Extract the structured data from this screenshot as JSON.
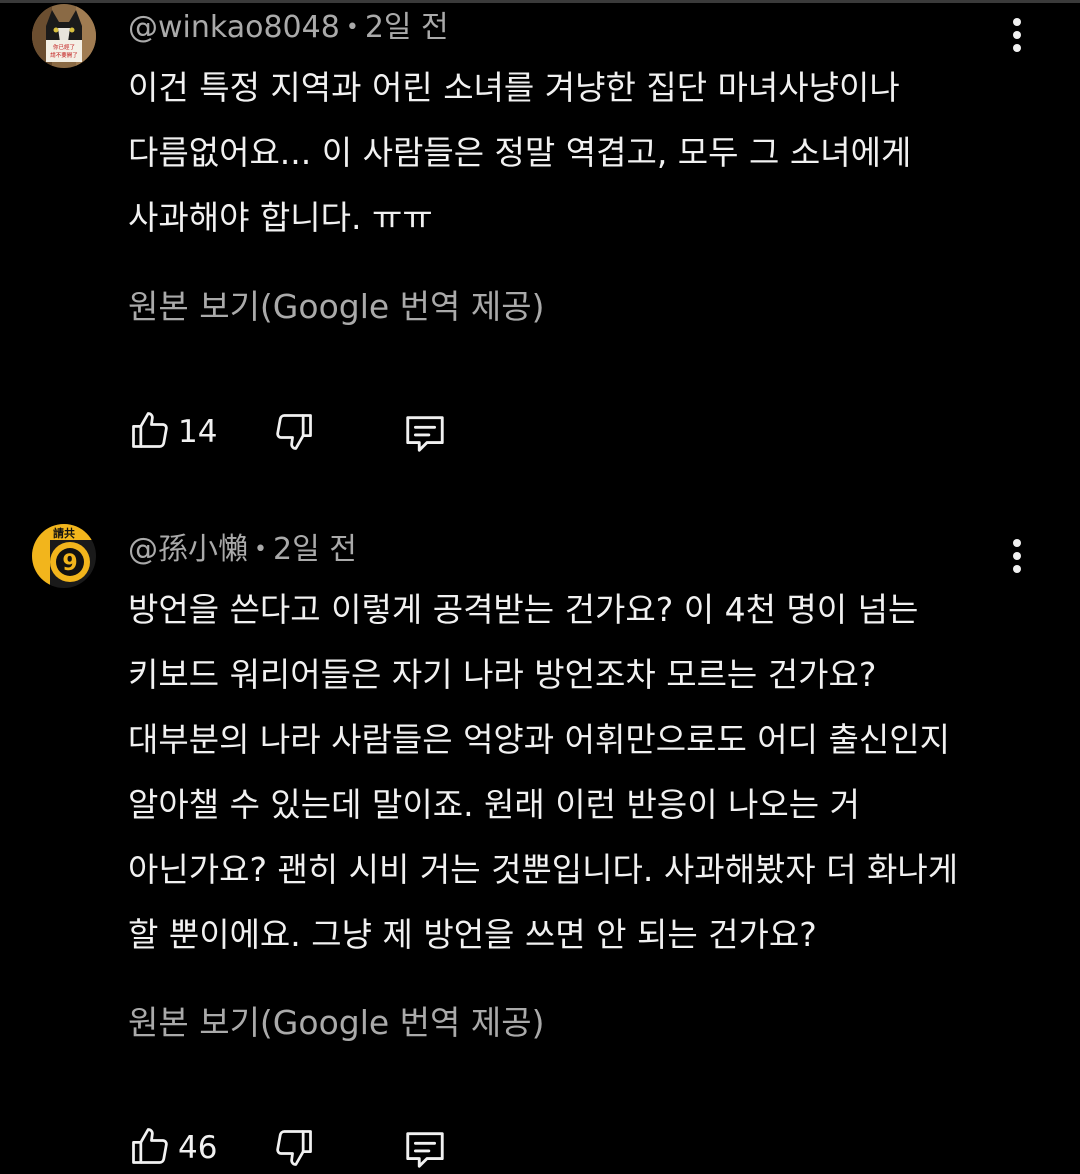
{
  "comments": [
    {
      "author": "@winkao8048",
      "separator": "•",
      "time": "2일 전",
      "avatar_icon": "cat-avatar-icon",
      "text_lines": [
        "이건 특정 지역과 어린 소녀를 겨냥한 집단 마녀사냥이나",
        "다름없어요... 이 사람들은 정말 역겹고, 모두 그 소녀에게",
        "사과해야 합니다. ㅠㅠ"
      ],
      "translate_link": "원본 보기(Google 번역 제공)",
      "likes": "14"
    },
    {
      "author": "@孫小懶",
      "separator": "•",
      "time": "2일 전",
      "avatar_icon": "logo-avatar-icon",
      "text_lines": [
        "방언을 쓴다고 이렇게 공격받는 건가요? 이 4천 명이 넘는",
        "키보드 워리어들은 자기 나라 방언조차 모르는 건가요?",
        "대부분의 나라 사람들은 억양과 어휘만으로도 어디 출신인지",
        "알아챌 수 있는데 말이죠. 원래 이런 반응이 나오는 거",
        "아닌가요? 괜히 시비 거는 것뿐입니다. 사과해봤자 더 화나게",
        "할 뿐이에요. 그냥 제 방언을 쓰면 안 되는 건가요?"
      ],
      "translate_link": "원본 보기(Google 번역 제공)",
      "likes": "46"
    }
  ],
  "avatar_marks": {
    "first": [
      "你已經了",
      "請不要開了"
    ],
    "second": [
      "請共",
      "9"
    ]
  },
  "icons": {
    "like": "thumbs-up-icon",
    "dislike": "thumbs-down-icon",
    "reply": "reply-comment-icon",
    "more": "more-vertical-icon"
  },
  "colors": {
    "background": "#000000",
    "primary_text": "#f1f1f1",
    "secondary_text": "#aaaaaa"
  }
}
